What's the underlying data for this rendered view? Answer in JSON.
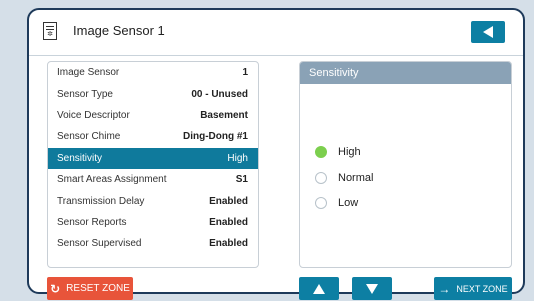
{
  "header": {
    "title": "Image Sensor 1"
  },
  "sensor_list": [
    {
      "label": "Image Sensor",
      "value": "1"
    },
    {
      "label": "Sensor Type",
      "value": "00 - Unused"
    },
    {
      "label": "Voice Descriptor",
      "value": "Basement"
    },
    {
      "label": "Sensor Chime",
      "value": "Ding-Dong #1"
    },
    {
      "label": "Sensitivity",
      "value": "High",
      "selected": true
    },
    {
      "label": "Smart Areas Assignment",
      "value": "S1"
    },
    {
      "label": "Transmission Delay",
      "value": "Enabled"
    },
    {
      "label": "Sensor Reports",
      "value": "Enabled"
    },
    {
      "label": "Sensor Supervised",
      "value": "Enabled"
    }
  ],
  "sensitivity_panel": {
    "title": "Sensitivity",
    "options": [
      {
        "label": "High",
        "selected": true
      },
      {
        "label": "Normal",
        "selected": false
      },
      {
        "label": "Low",
        "selected": false
      }
    ]
  },
  "footer": {
    "reset_label": "RESET ZONE",
    "next_label": "NEXT ZONE"
  },
  "colors": {
    "accent": "#0d7fa3",
    "selected_row": "#0f7a9c",
    "reset": "#e8543a",
    "radio_on": "#7ccf4e",
    "panel_header": "#8aa2b6"
  },
  "icons": {
    "header": "image-sensor-icon",
    "back": "back-arrow-icon",
    "reset": "refresh-icon",
    "up": "up-arrow-icon",
    "down": "down-arrow-icon",
    "next": "right-arrow-icon"
  }
}
